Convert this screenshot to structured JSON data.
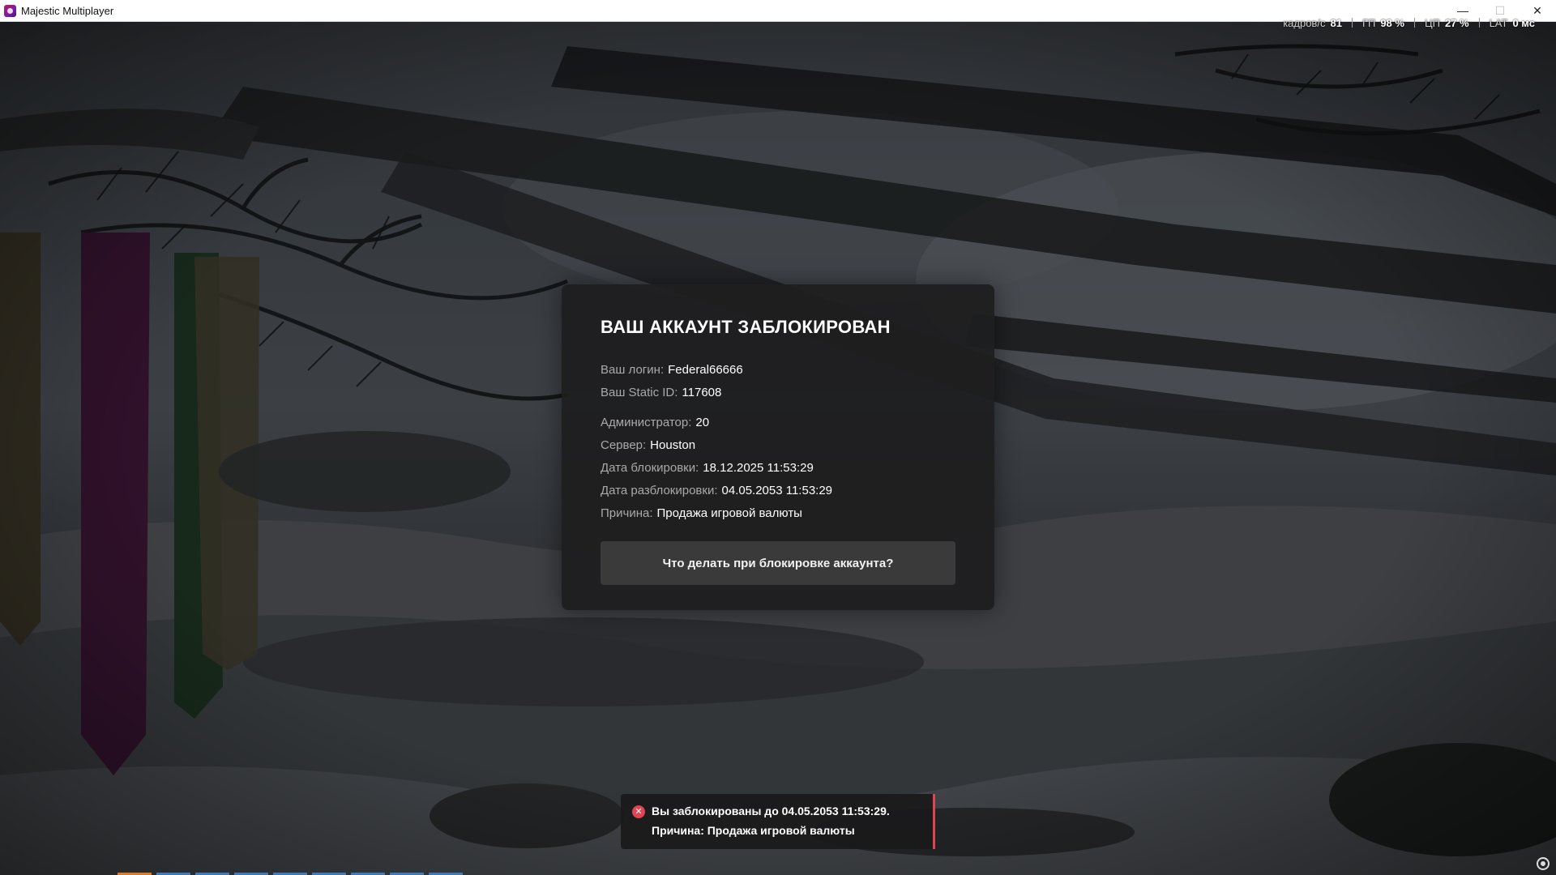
{
  "window": {
    "title": "Majestic Multiplayer",
    "minimize_glyph": "—",
    "maximize_glyph": "☐",
    "close_glyph": "✕"
  },
  "perf": {
    "fps_label": "кадров/с",
    "fps_value": "81",
    "gpu_label": "ГП",
    "gpu_value": "98 %",
    "cpu_label": "ЦП",
    "cpu_value": "27 %",
    "lat_label": "LAT",
    "lat_value": "0 мс"
  },
  "ban_panel": {
    "title": "ВАШ АККАУНТ ЗАБЛОКИРОВАН",
    "login_label": "Ваш логин:",
    "login_value": "Federal66666",
    "static_id_label": "Ваш Static ID:",
    "static_id_value": "117608",
    "admin_label": "Администратор:",
    "admin_value": "20",
    "server_label": "Сервер:",
    "server_value": "Houston",
    "ban_date_label": "Дата блокировки:",
    "ban_date_value": "18.12.2025 11:53:29",
    "unban_date_label": "Дата разблокировки:",
    "unban_date_value": "04.05.2053 11:53:29",
    "reason_label": "Причина:",
    "reason_value": "Продажа игровой валюты",
    "help_button": "Что делать при блокировке аккаунта?"
  },
  "toast": {
    "icon": "error-icon",
    "line1": "Вы заблокированы до 04.05.2053 11:53:29.",
    "line2": "Причина: Продажа игровой валюты",
    "accent_color": "#e04452"
  },
  "colors": {
    "panel_bg": "#1e1e1f",
    "button_bg": "#3a3a3b",
    "label_gray": "#a9a9a9"
  }
}
